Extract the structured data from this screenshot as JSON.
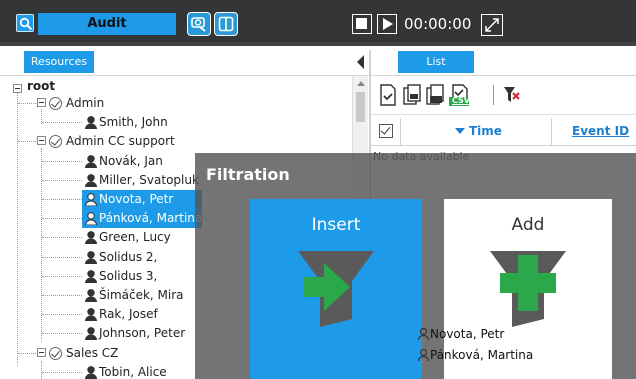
{
  "topbar": {
    "module_tab": "Audit",
    "timer": "00:00:00"
  },
  "resources": {
    "tab_label": "Resources"
  },
  "tree": {
    "root": "root",
    "items": [
      {
        "label": "Admin",
        "kind": "group"
      },
      {
        "label": "Smith, John",
        "kind": "user"
      },
      {
        "label": "Admin CC support",
        "kind": "group"
      },
      {
        "label": "Novák, Jan",
        "kind": "user"
      },
      {
        "label": "Miller, Svatopluk",
        "kind": "user"
      },
      {
        "label": "Novota, Petr",
        "kind": "user",
        "selected": true
      },
      {
        "label": "Pánková, Martina",
        "kind": "user",
        "selected": true
      },
      {
        "label": "Green, Lucy",
        "kind": "user"
      },
      {
        "label": "Solidus 2,",
        "kind": "user"
      },
      {
        "label": "Solidus 3,",
        "kind": "user"
      },
      {
        "label": "Šimáček, Mira",
        "kind": "user"
      },
      {
        "label": "Rak, Josef",
        "kind": "user"
      },
      {
        "label": "Johnson, Peter",
        "kind": "user"
      },
      {
        "label": "Sales CZ",
        "kind": "group"
      },
      {
        "label": "Tobin, Alice",
        "kind": "user"
      }
    ]
  },
  "list": {
    "tab_label": "List",
    "columns": {
      "time": "Time",
      "event_id": "Event ID"
    },
    "empty_text": "No data available",
    "toolbar_icons": [
      "export-icon",
      "copy-icon",
      "print-icon",
      "csv-icon",
      "clear-filter-icon"
    ],
    "csv_label": "CSV"
  },
  "filtration": {
    "title": "Filtration",
    "insert_label": "Insert",
    "add_label": "Add",
    "dragged_items": [
      "Novota, Petr",
      "Pánková, Martina"
    ]
  },
  "colors": {
    "accent": "#1e9be8",
    "topbar": "#333537",
    "overlay": "#555555",
    "green": "#2aa84a"
  }
}
